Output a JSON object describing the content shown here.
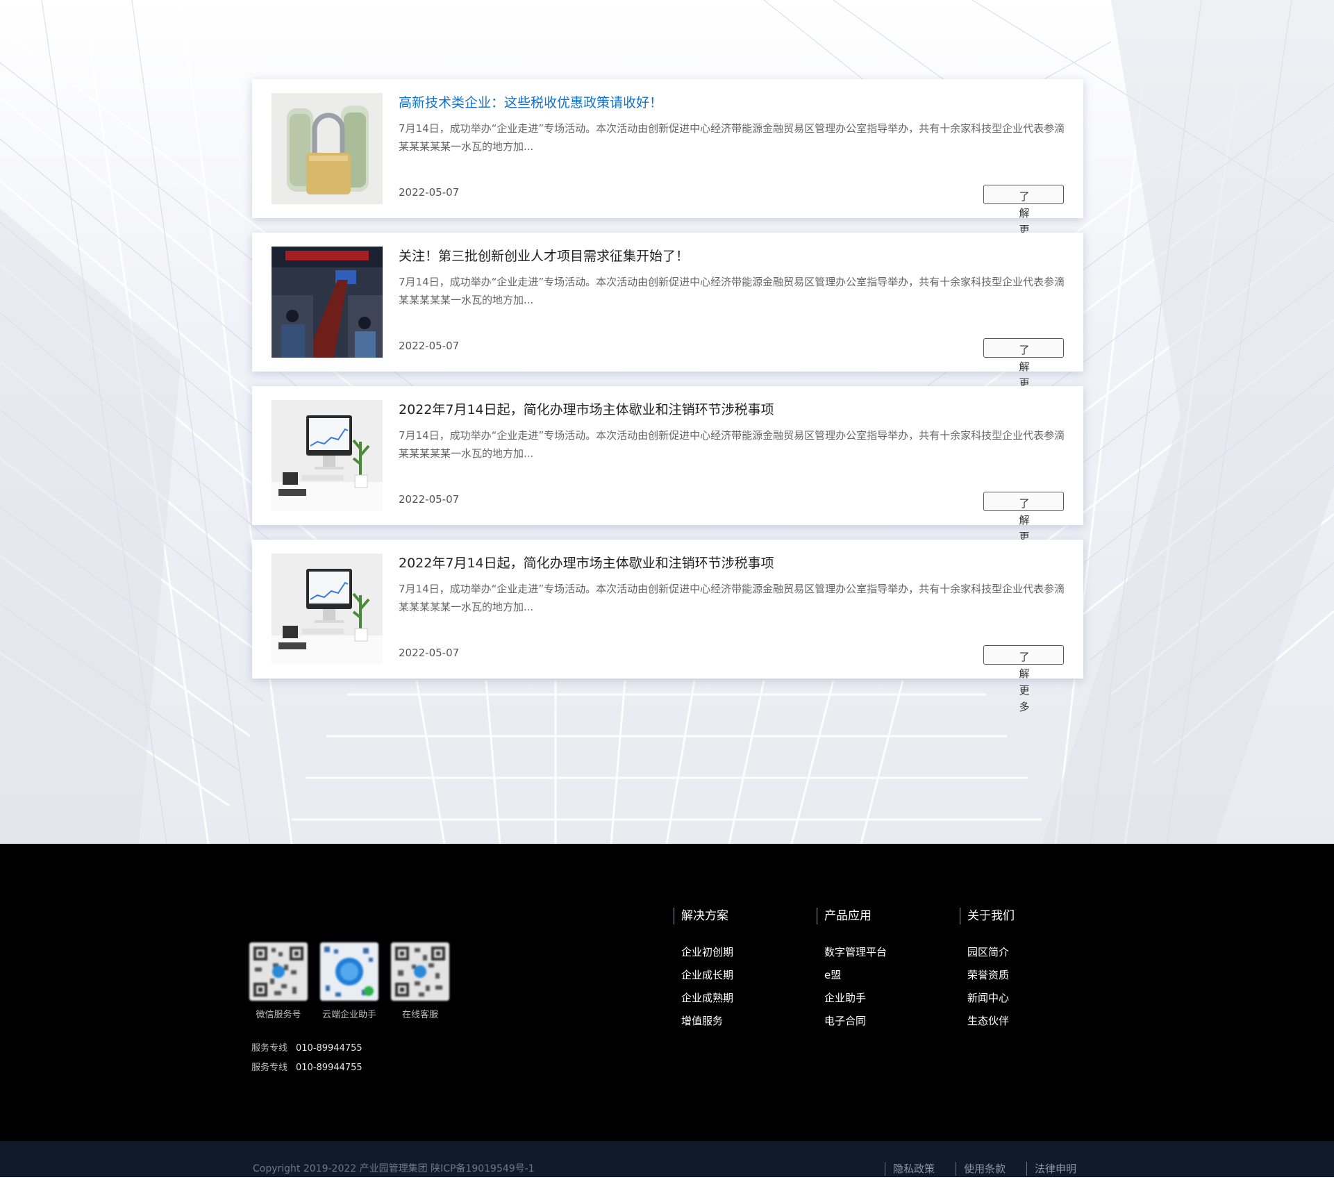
{
  "articles": [
    {
      "title": "高新技术类企业：这些税收优惠政策请收好！",
      "summary": "7月14日，成功举办“企业走进”专场活动。本次活动由创新促进中心经济带能源金融贸易区管理办公室指导举办，共有十余家科技型企业代表参滴某某某某某一水瓦的地方加...",
      "date": "2022-05-07",
      "more_label": "了解更多",
      "thumb_icon": "money-lock-photo",
      "highlight": true
    },
    {
      "title": "关注！第三批创新创业人才项目需求征集开始了！",
      "summary": "7月14日，成功举办“企业走进”专场活动。本次活动由创新促进中心经济带能源金融贸易区管理办公室指导举办，共有十余家科技型企业代表参滴某某某某某一水瓦的地方加...",
      "date": "2022-05-07",
      "more_label": "了解更多",
      "thumb_icon": "meeting-room-photo",
      "highlight": false
    },
    {
      "title": "2022年7月14日起，简化办理市场主体歇业和注销环节涉税事项",
      "summary": "7月14日，成功举办“企业走进”专场活动。本次活动由创新促进中心经济带能源金融贸易区管理办公室指导举办，共有十余家科技型企业代表参滴某某某某某一水瓦的地方加...",
      "date": "2022-05-07",
      "more_label": "了解更多",
      "thumb_icon": "desk-computer-photo",
      "highlight": false
    },
    {
      "title": "2022年7月14日起，简化办理市场主体歇业和注销环节涉税事项",
      "summary": "7月14日，成功举办“企业走进”专场活动。本次活动由创新促进中心经济带能源金融贸易区管理办公室指导举办，共有十余家科技型企业代表参滴某某某某某一水瓦的地方加...",
      "date": "2022-05-07",
      "more_label": "了解更多",
      "thumb_icon": "desk-computer-photo",
      "highlight": false
    }
  ],
  "footer": {
    "qr_codes": [
      {
        "label": "微信服务号",
        "icon": "qr-code-icon"
      },
      {
        "label": "云端企业助手",
        "icon": "qr-code-icon"
      },
      {
        "label": "在线客服",
        "icon": "qr-code-icon"
      }
    ],
    "hotlines": [
      {
        "label": "服务专线",
        "number": "010-89944755"
      },
      {
        "label": "服务专线",
        "number": "010-89944755"
      }
    ],
    "columns": [
      {
        "title": "解决方案",
        "items": [
          "企业初创期",
          "企业成长期",
          "企业成熟期",
          "增值服务"
        ]
      },
      {
        "title": "产品应用",
        "items": [
          "数字管理平台",
          "e盟",
          "企业助手",
          "电子合同"
        ]
      },
      {
        "title": "关于我们",
        "items": [
          "园区简介",
          "荣誉资质",
          "新闻中心",
          "生态伙伴"
        ]
      }
    ],
    "copyright": "Copyright 2019-2022 产业园管理集团 陕ICP备19019549号-1",
    "legal_links": [
      "隐私政策",
      "使用条款",
      "法律申明"
    ]
  },
  "colors": {
    "link_blue": "#1470c8",
    "footer_bg": "#000000",
    "bottom_bar_bg": "#111a2b"
  }
}
